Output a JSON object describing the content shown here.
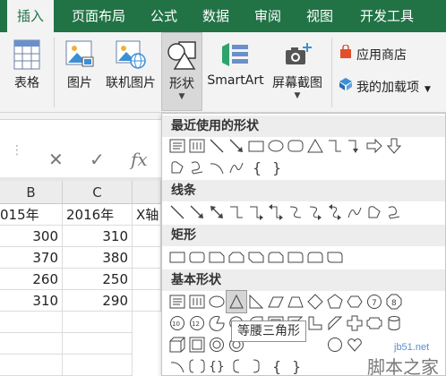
{
  "ribbon_tabs": [
    "插入",
    "页面布局",
    "公式",
    "数据",
    "审阅",
    "视图",
    "开发工具"
  ],
  "ribbon": {
    "table": "表格",
    "picture": "图片",
    "online_picture": "联机图片",
    "shapes": "形状",
    "smartart": "SmartArt",
    "screenshot": "屏幕截图",
    "app_store": "应用商店",
    "my_addins": "我的加载项"
  },
  "formula_bar": {
    "cancel": "✕",
    "enter": "✓",
    "fx": "fx"
  },
  "sheet": {
    "col_headers": [
      "B",
      "C"
    ],
    "header_row": [
      "015年",
      "2016年",
      "X轴"
    ],
    "rows": [
      [
        "300",
        "310"
      ],
      [
        "370",
        "380"
      ],
      [
        "260",
        "250"
      ],
      [
        "310",
        "290"
      ]
    ]
  },
  "shapes_menu": {
    "sections": [
      "最近使用的形状",
      "线条",
      "矩形",
      "基本形状"
    ],
    "tooltip": "等腰三角形"
  },
  "watermark": {
    "site": "jb51.net",
    "name": "脚本之家"
  },
  "colors": {
    "accent": "#217346"
  }
}
